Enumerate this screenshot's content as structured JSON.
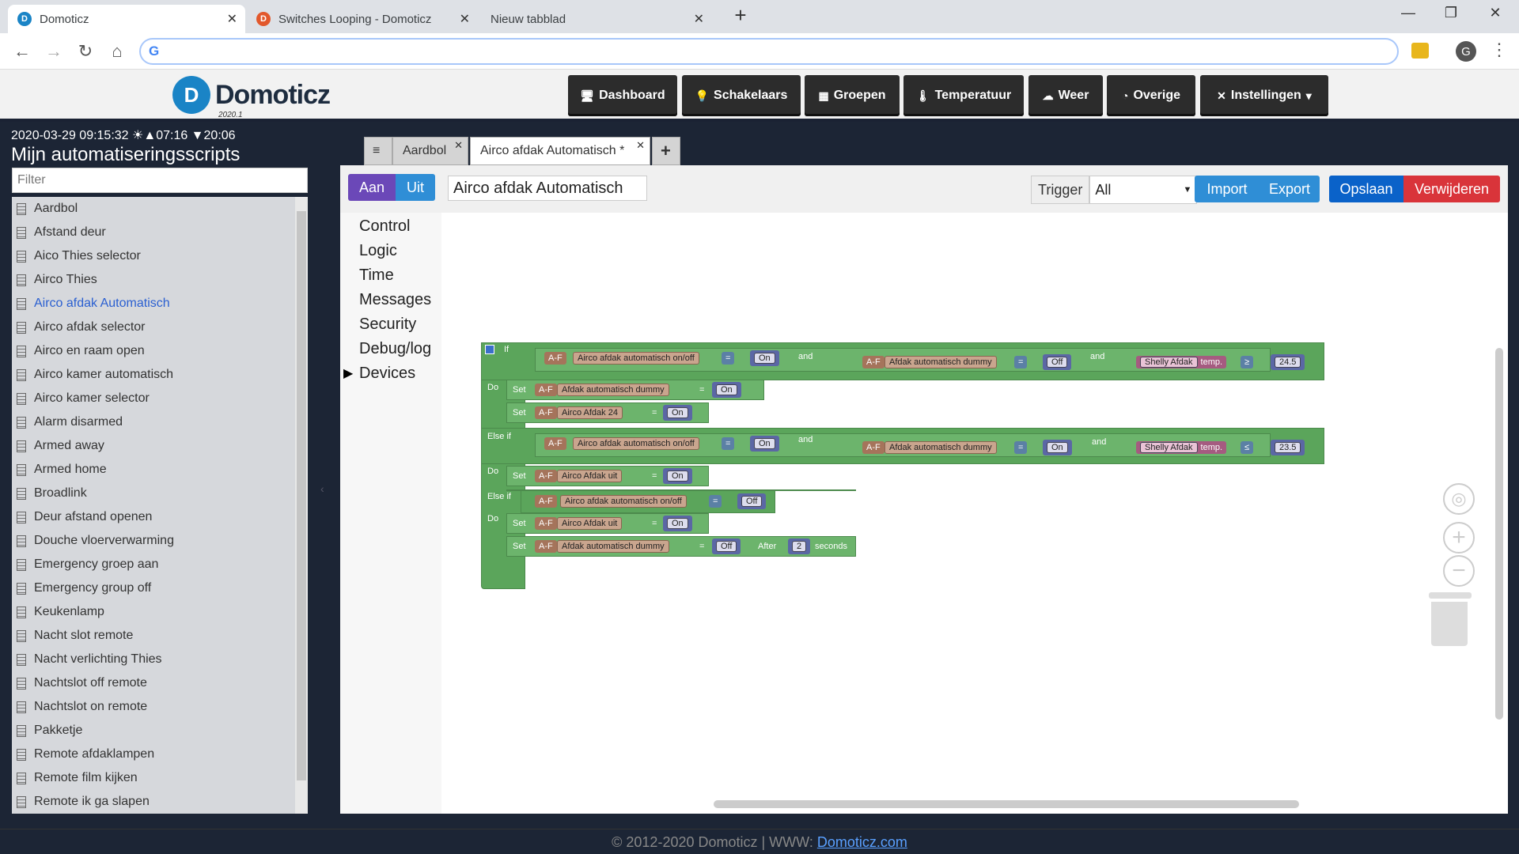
{
  "browser": {
    "tabs": [
      {
        "label": "Domoticz"
      },
      {
        "label": "Switches Looping - Domoticz"
      },
      {
        "label": "Nieuw tabblad"
      }
    ],
    "new_tab": "+",
    "avatar": "G",
    "win": {
      "min": "—",
      "max": "❐",
      "close": "✕"
    }
  },
  "app": {
    "logo_name": "Domoticz",
    "logo_version": "2020.1",
    "nav": [
      {
        "label": "Dashboard",
        "icon": "dashboard-icon"
      },
      {
        "label": "Schakelaars",
        "icon": "bulb-icon"
      },
      {
        "label": "Groepen",
        "icon": "group-icon"
      },
      {
        "label": "Temperatuur",
        "icon": "thermometer-icon"
      },
      {
        "label": "Weer",
        "icon": "cloud-icon"
      },
      {
        "label": "Overige",
        "icon": "gauge-icon"
      },
      {
        "label": "Instellingen",
        "icon": "tools-icon"
      }
    ]
  },
  "sidebar": {
    "datetime": "2020-03-29 09:15:32 ☀▲07:16 ▼20:06",
    "title": "Mijn automatiseringsscripts",
    "filter_placeholder": "Filter",
    "scripts": [
      "Aardbol",
      "Afstand deur",
      "Aico Thies selector",
      "Airco Thies",
      "Airco afdak Automatisch",
      "Airco afdak selector",
      "Airco en raam open",
      "Airco kamer automatisch",
      "Airco kamer selector",
      "Alarm disarmed",
      "Armed away",
      "Armed home",
      "Broadlink",
      "Deur afstand openen",
      "Douche vloerverwarming",
      "Emergency groep aan",
      "Emergency group off",
      "Keukenlamp",
      "Nacht slot remote",
      "Nacht verlichting Thies",
      "Nachtslot off remote",
      "Nachtslot on remote",
      "Pakketje",
      "Remote afdaklampen",
      "Remote film kijken",
      "Remote ik ga slapen"
    ],
    "selected": "Airco afdak Automatisch"
  },
  "editor": {
    "tabs": [
      {
        "label": "Aardbol"
      },
      {
        "label": "Airco afdak Automatisch *"
      }
    ],
    "add_tab": "+",
    "on_label": "Aan",
    "off_label": "Uit",
    "script_name": "Airco afdak Automatisch",
    "trigger_label": "Trigger",
    "trigger_value": "All",
    "import_label": "Import",
    "export_label": "Export",
    "save_label": "Opslaan",
    "delete_label": "Verwijderen",
    "categories": [
      "Control",
      "Logic",
      "Time",
      "Messages",
      "Security",
      "Debug/log",
      "Devices"
    ]
  },
  "blocks": {
    "if": "If",
    "do": "Do",
    "elseif": "Else if",
    "set": "Set",
    "af": "A-F",
    "and": "and",
    "eq": "=",
    "after": "After",
    "seconds": "seconds",
    "dev_onoff": "Airco afdak automatisch on/off",
    "dev_dummy": "Afdak automatisch dummy",
    "dev_24": "Airco Afdak 24",
    "dev_uit": "Airco Afdak uit",
    "dev_shelly": "Shelly Afdak",
    "temp": "temp.",
    "on": "On",
    "off": "Off",
    "ge": "≥",
    "le": "≤",
    "v245": "24.5",
    "v235": "23.5",
    "two": "2"
  },
  "footer": {
    "text": "© 2012-2020 Domoticz | WWW: ",
    "link": "Domoticz.com"
  }
}
